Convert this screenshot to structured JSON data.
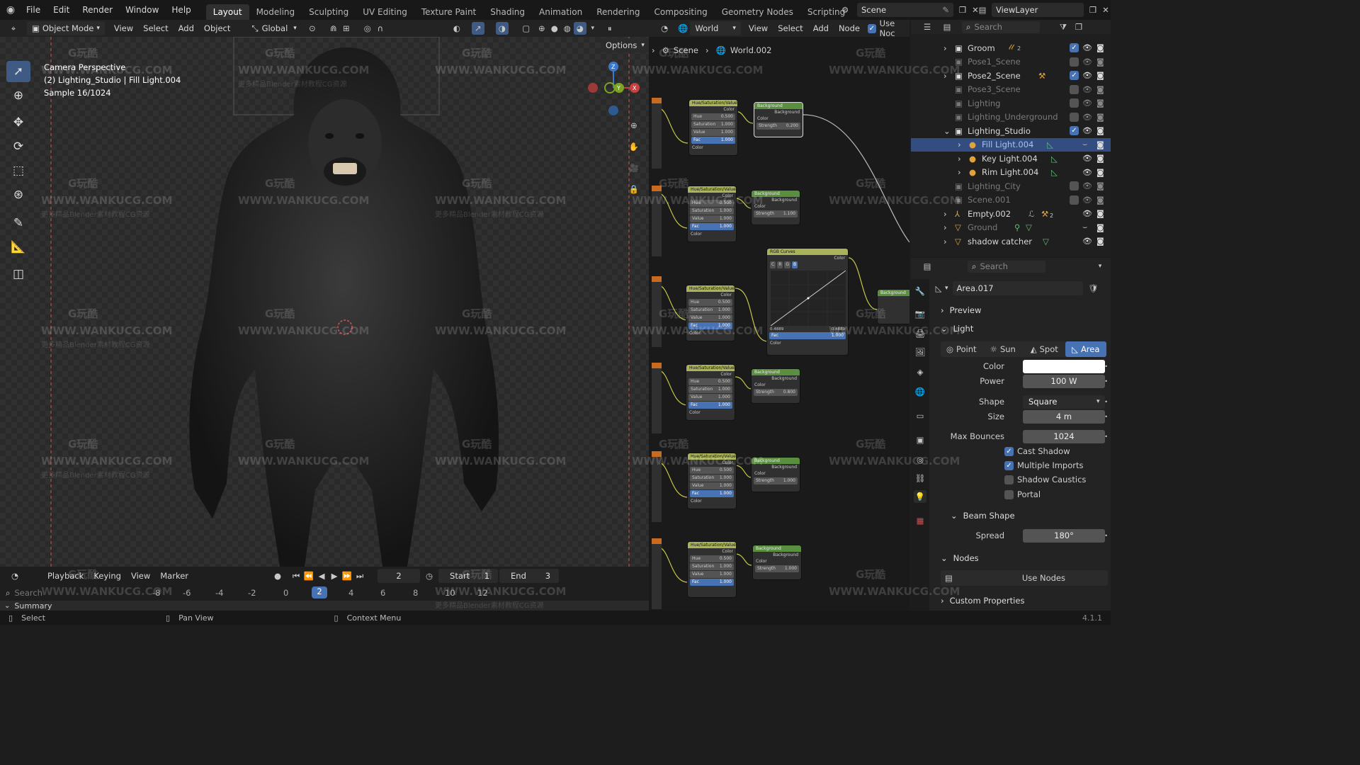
{
  "topbar": {
    "menus": [
      "File",
      "Edit",
      "Render",
      "Window",
      "Help"
    ],
    "workspaces": [
      "Layout",
      "Modeling",
      "Sculpting",
      "UV Editing",
      "Texture Paint",
      "Shading",
      "Animation",
      "Rendering",
      "Compositing",
      "Geometry Nodes",
      "Scripting"
    ],
    "active_workspace": "Layout",
    "scene": "Scene",
    "view_layer": "ViewLayer"
  },
  "viewport": {
    "mode": "Object Mode",
    "menus": [
      "View",
      "Select",
      "Add",
      "Object"
    ],
    "orientation": "Global",
    "options": "Options",
    "info_line1": "Camera Perspective",
    "info_line2": "(2) Lighting_Studio | Fill Light.004",
    "info_line3": "Sample 16/1024",
    "gizmo_x": "X",
    "gizmo_y": "Y",
    "gizmo_z": "Z"
  },
  "node_editor": {
    "world_type": "World",
    "menus": [
      "View",
      "Select",
      "Add",
      "Node"
    ],
    "use_nodes": "Use Noc",
    "breadcrumb_scene": "Scene",
    "breadcrumb_world": "World.002",
    "hsv_title": "Hue/Saturation/Value",
    "bg_title": "Background",
    "rgb_title": "RGB Curves",
    "lbl_color": "Color",
    "lbl_background": "Background",
    "lbl_hue": "Hue",
    "lbl_sat": "Saturation",
    "lbl_val": "Value",
    "lbl_fac": "Fac",
    "lbl_strength": "Strength",
    "v_hue": "0.500",
    "v_one": "1.000",
    "strengths": [
      "0.200",
      "1.100",
      "0.800",
      "1.000",
      "1.000"
    ],
    "rgb_x": "0.4889",
    "rgb_y": "0.4889",
    "rgb_channels": [
      "C",
      "R",
      "G",
      "B"
    ]
  },
  "outliner": {
    "search_placeholder": "Search",
    "items": [
      {
        "label": "Groom",
        "count": "2"
      },
      {
        "label": "Pose1_Scene"
      },
      {
        "label": "Pose2_Scene"
      },
      {
        "label": "Pose3_Scene"
      },
      {
        "label": "Lighting"
      },
      {
        "label": "Lighting_Underground"
      },
      {
        "label": "Lighting_Studio"
      },
      {
        "label": "Fill Light.004"
      },
      {
        "label": "Key Light.004"
      },
      {
        "label": "Rim Light.004"
      },
      {
        "label": "Lighting_City"
      },
      {
        "label": "Scene.001"
      },
      {
        "label": "Empty.002",
        "count": "2"
      },
      {
        "label": "Ground"
      },
      {
        "label": "shadow catcher"
      }
    ]
  },
  "properties": {
    "search_placeholder": "Search",
    "datablock": "Area.017",
    "preview": "Preview",
    "light": "Light",
    "light_types": [
      "Point",
      "Sun",
      "Spot",
      "Area"
    ],
    "active_type": "Area",
    "color_label": "Color",
    "color_value": "#ffffff",
    "power_label": "Power",
    "power_value": "100 W",
    "shape_label": "Shape",
    "shape_value": "Square",
    "size_label": "Size",
    "size_value": "4 m",
    "max_bounces_label": "Max Bounces",
    "max_bounces_value": "1024",
    "cast_shadow": "Cast Shadow",
    "multiple_imports": "Multiple Imports",
    "shadow_caustics": "Shadow Caustics",
    "portal": "Portal",
    "beam_shape": "Beam Shape",
    "spread_label": "Spread",
    "spread_value": "180°",
    "nodes": "Nodes",
    "use_nodes": "Use Nodes",
    "custom_properties": "Custom Properties"
  },
  "timeline": {
    "menus": [
      "Playback",
      "Keying",
      "View",
      "Marker"
    ],
    "current_frame": "2",
    "start_label": "Start",
    "start_value": "1",
    "end_label": "End",
    "end_value": "3",
    "ruler": [
      "-8",
      "-6",
      "-4",
      "-2",
      "0",
      "2",
      "4",
      "6",
      "8",
      "10",
      "12"
    ],
    "search_placeholder": "Search",
    "summary": "Summary"
  },
  "statusbar": {
    "select": "Select",
    "pan_view": "Pan View",
    "context_menu": "Context Menu",
    "version": "4.1.1"
  },
  "watermark": {
    "brand": "G玩酷",
    "url": "WWW.WANKUCG.COM",
    "sub": "更多精品Blender素材教程CG资源"
  },
  "colors": {
    "accent": "#4772b3",
    "selection": "#334d80",
    "hsv_header": "#aab35a",
    "bg_header": "#5a8f3f",
    "rgb_header": "#aab35a"
  }
}
